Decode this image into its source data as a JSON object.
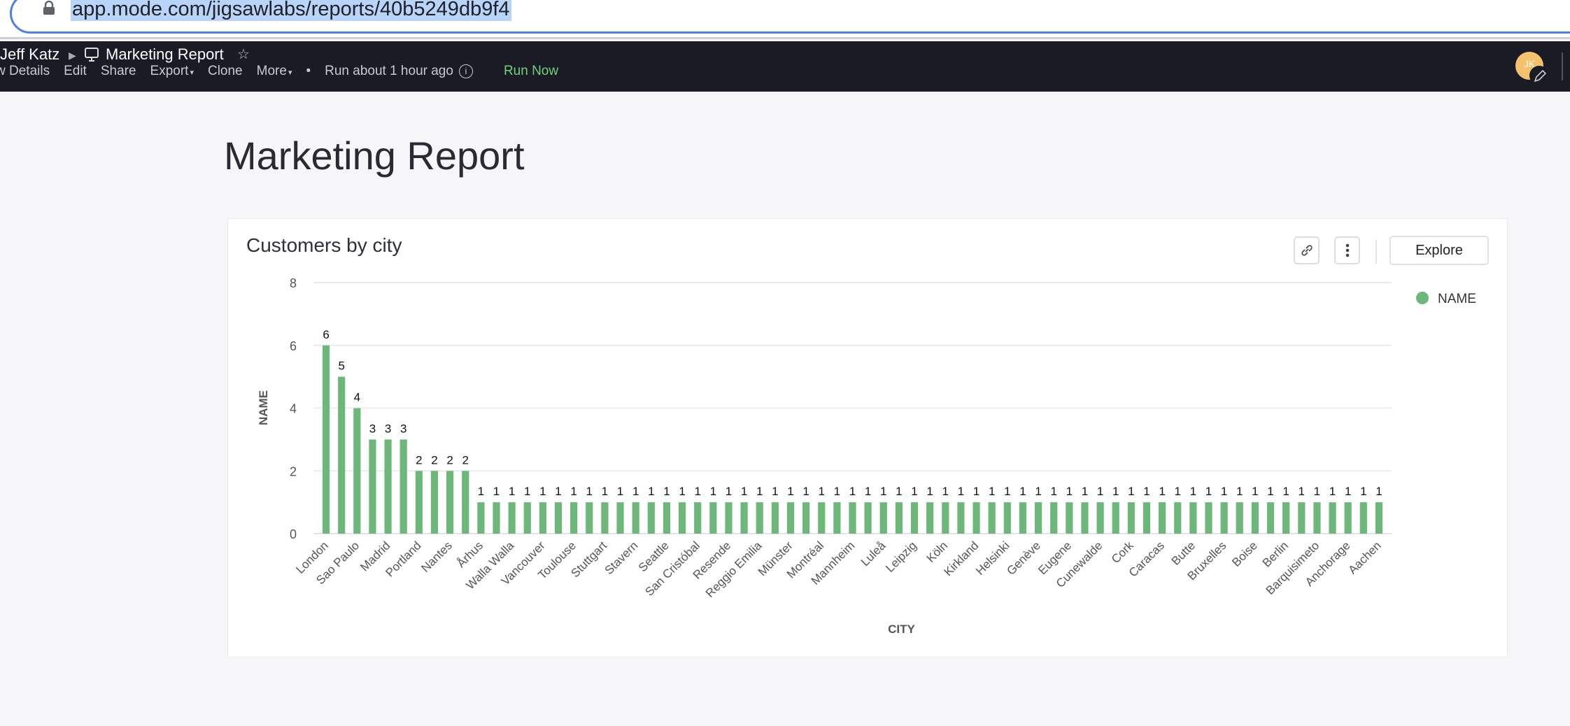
{
  "browser": {
    "url": "app.mode.com/jigsawlabs/reports/40b5249db9f4"
  },
  "topnav": {
    "owner": "Jeff Katz",
    "report_name": "Marketing Report",
    "actions": [
      "w Details",
      "Edit",
      "Share",
      "Export",
      "Clone",
      "More"
    ],
    "run_status": "Run about 1 hour ago",
    "run_now": "Run Now",
    "avatar_initials": "JK"
  },
  "page": {
    "title": "Marketing Report"
  },
  "card": {
    "title": "Customers by city",
    "explore_label": "Explore"
  },
  "chart_data": {
    "type": "bar",
    "title": "Customers by city",
    "xlabel": "CITY",
    "ylabel": "NAME",
    "ylim": [
      0,
      8
    ],
    "yticks": [
      0,
      2,
      4,
      6,
      8
    ],
    "grid": true,
    "legend": {
      "position": "top-right",
      "entries": [
        "NAME"
      ]
    },
    "color": "#6db77b",
    "categories": [
      "London",
      "",
      "Sao Paulo",
      "",
      "Madrid",
      "",
      "Portland",
      "",
      "Nantes",
      "",
      "Århus",
      "",
      "Walla Walla",
      "",
      "Vancouver",
      "",
      "Toulouse",
      "",
      "Stuttgart",
      "",
      "Stavern",
      "",
      "Seattle",
      "",
      "San Cristóbal",
      "",
      "Resende",
      "",
      "Reggio Emilia",
      "",
      "Münster",
      "",
      "Montréal",
      "",
      "Mannheim",
      "",
      "Luleå",
      "",
      "Leipzig",
      "",
      "Köln",
      "",
      "Kirkland",
      "",
      "Helsinki",
      "",
      "Genève",
      "",
      "Eugene",
      "",
      "Cunewalde",
      "",
      "Cork",
      "",
      "Caracas",
      "",
      "Butte",
      "",
      "Bruxelles",
      "",
      "Boise",
      "",
      "Berlin",
      "",
      "Barquisimeto",
      "",
      "Anchorage",
      "",
      "Aachen"
    ],
    "series": [
      {
        "name": "NAME",
        "values": [
          6,
          5,
          4,
          3,
          3,
          3,
          2,
          2,
          2,
          2,
          1,
          1,
          1,
          1,
          1,
          1,
          1,
          1,
          1,
          1,
          1,
          1,
          1,
          1,
          1,
          1,
          1,
          1,
          1,
          1,
          1,
          1,
          1,
          1,
          1,
          1,
          1,
          1,
          1,
          1,
          1,
          1,
          1,
          1,
          1,
          1,
          1,
          1,
          1,
          1,
          1,
          1,
          1,
          1,
          1,
          1,
          1,
          1,
          1,
          1,
          1,
          1,
          1,
          1,
          1,
          1,
          1,
          1,
          1
        ]
      }
    ]
  }
}
